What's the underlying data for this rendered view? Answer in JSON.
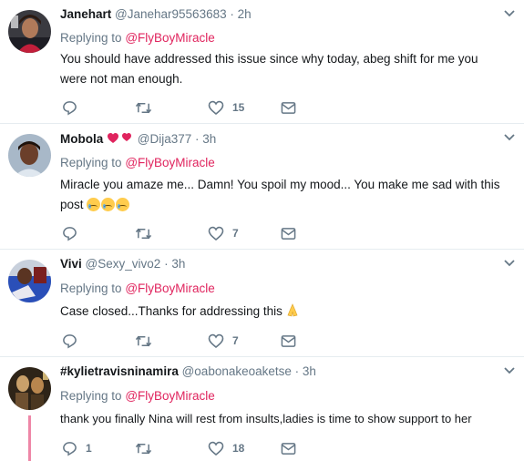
{
  "colors": {
    "accent": "#e0245e",
    "muted": "#657786",
    "divider": "#e6ecf0"
  },
  "tweets": [
    {
      "name": "Janehart",
      "handle": "@Janehar95563683",
      "dot": "·",
      "time": "2h",
      "replying_label": "Replying to",
      "replying_to": "@FlyBoyMiracle",
      "text_lines": [
        "You should have addressed this issue since why today, abeg shift for me you",
        "were not man enough."
      ],
      "reply_count": "",
      "retweet_count": "",
      "like_count": "15"
    },
    {
      "name": "Mobola",
      "name_emoji": "heart-emoji",
      "handle": "@Dija377",
      "dot": "·",
      "time": "3h",
      "replying_label": "Replying to",
      "replying_to": "@FlyBoyMiracle",
      "text_lines": [
        "Miracle you amaze me...  Damn! You spoil my mood...  You make me sad with this",
        "post"
      ],
      "reply_count": "",
      "retweet_count": "",
      "like_count": "7"
    },
    {
      "name": "Vivi",
      "handle": "@Sexy_vivo2",
      "dot": "·",
      "time": "3h",
      "replying_label": "Replying to",
      "replying_to": "@FlyBoyMiracle",
      "text_lines": [
        "Case closed...Thanks for addressing this"
      ],
      "reply_count": "",
      "retweet_count": "",
      "like_count": "7"
    },
    {
      "name": "#kylietravisninamira",
      "handle": "@oabonakeoaketse",
      "dot": "·",
      "time": "3h",
      "replying_label": "Replying to",
      "replying_to": "@FlyBoyMiracle",
      "text_lines": [
        "thank you finally Nina will rest from insults,ladies is time to show support to her"
      ],
      "reply_count": "1",
      "retweet_count": "",
      "like_count": "18"
    }
  ]
}
